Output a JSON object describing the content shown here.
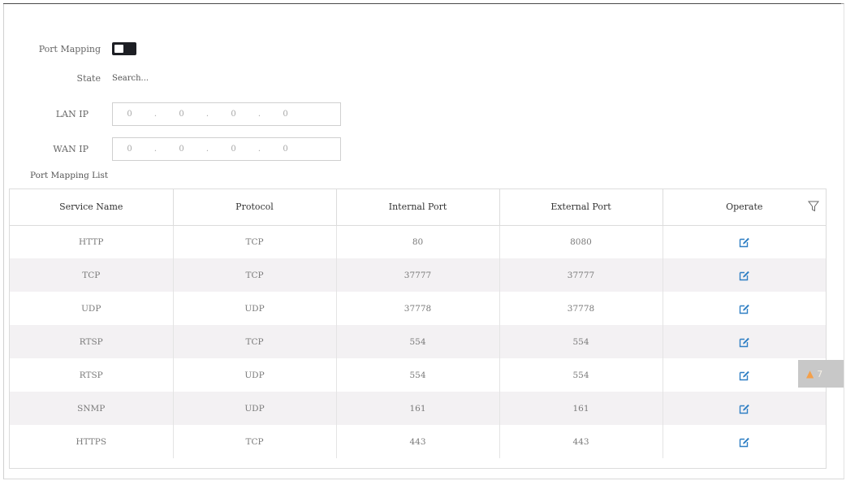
{
  "form": {
    "port_mapping_label": "Port Mapping",
    "port_mapping_enabled": true,
    "state_label": "State",
    "state_value": "Search...",
    "lan_ip_label": "LAN IP",
    "lan_ip": [
      "0",
      "0",
      "0",
      "0"
    ],
    "wan_ip_label": "WAN IP",
    "wan_ip": [
      "0",
      "0",
      "0",
      "0"
    ]
  },
  "list": {
    "title": "Port Mapping List",
    "columns": [
      "Service Name",
      "Protocol",
      "Internal Port",
      "External Port",
      "Operate"
    ],
    "rows": [
      [
        "HTTP",
        "TCP",
        "80",
        "8080"
      ],
      [
        "TCP",
        "TCP",
        "37777",
        "37777"
      ],
      [
        "UDP",
        "UDP",
        "37778",
        "37778"
      ],
      [
        "RTSP",
        "TCP",
        "554",
        "554"
      ],
      [
        "RTSP",
        "UDP",
        "554",
        "554"
      ],
      [
        "SNMP",
        "UDP",
        "161",
        "161"
      ],
      [
        "HTTPS",
        "TCP",
        "443",
        "443"
      ]
    ],
    "operate_icon": "edit-icon",
    "filter_icon": "filter-icon"
  },
  "badge": {
    "icon": "warning-icon",
    "count": "7"
  },
  "colors": {
    "edit_icon": "#2f7fc4",
    "toggle_on": "#1d1f24",
    "row_alt": "#f3f1f3",
    "badge_bg": "#c8c8c8",
    "warning": "#f4a04a"
  }
}
